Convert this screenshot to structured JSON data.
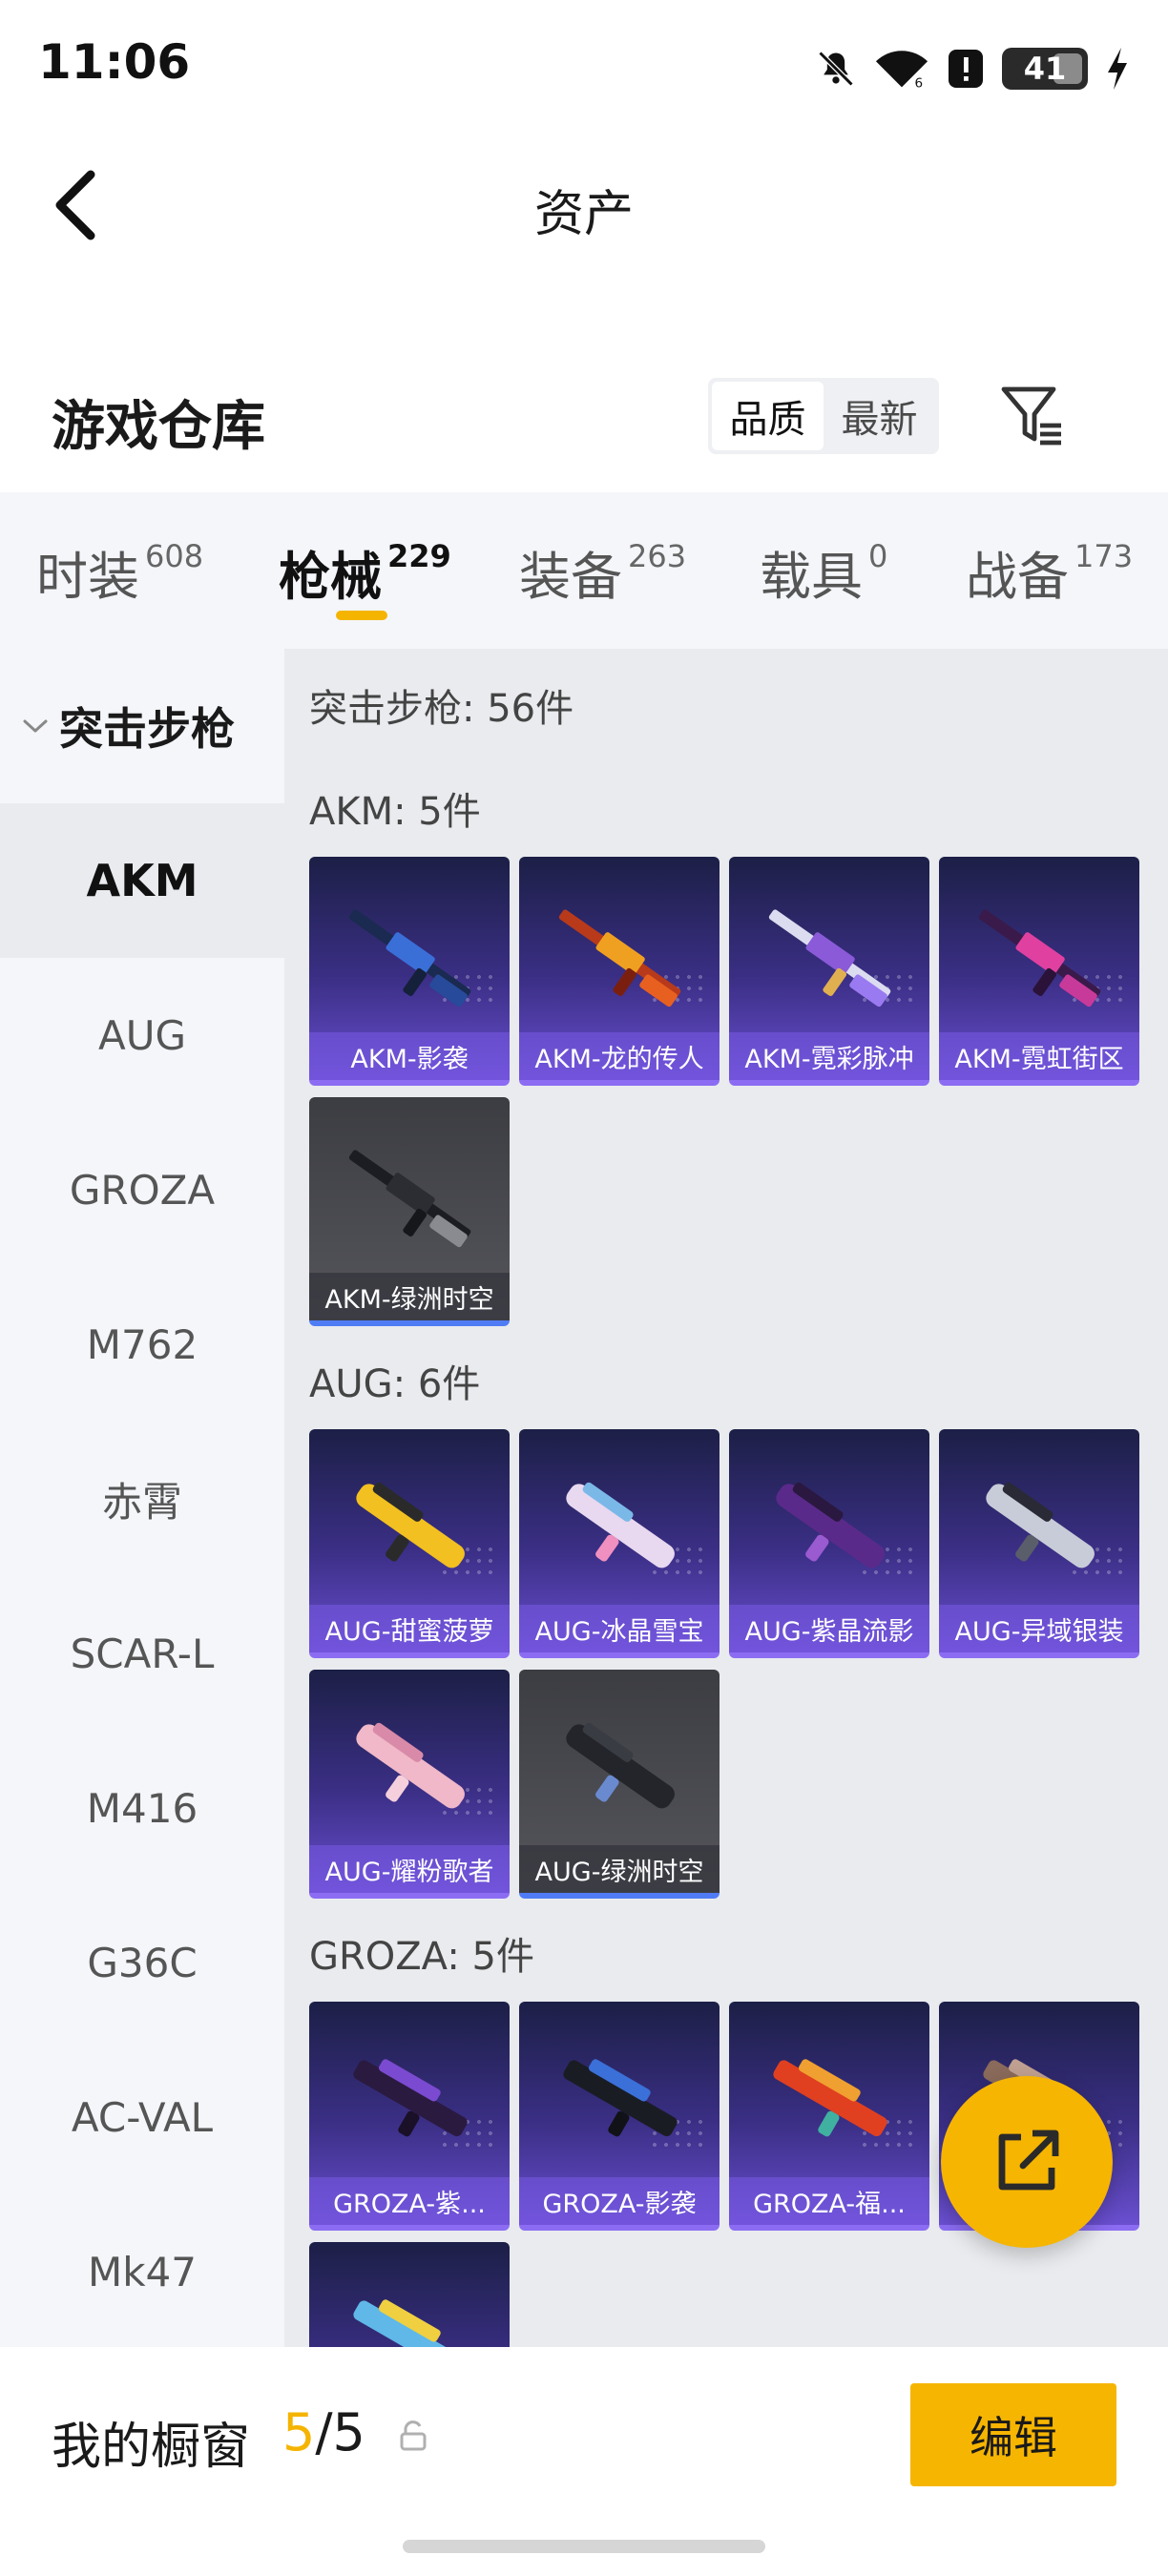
{
  "status_bar": {
    "time": "11:06",
    "battery": "41"
  },
  "header": {
    "title": "资产"
  },
  "warehouse": {
    "title": "游戏仓库",
    "sort_options": [
      "品质",
      "最新"
    ]
  },
  "tabs": [
    {
      "label": "时装",
      "count": "608"
    },
    {
      "label": "枪械",
      "count": "229"
    },
    {
      "label": "装备",
      "count": "263"
    },
    {
      "label": "载具",
      "count": "0"
    },
    {
      "label": "战备",
      "count": "173"
    }
  ],
  "sidebar": {
    "group": "突击步枪",
    "items": [
      "AKM",
      "AUG",
      "GROZA",
      "M762",
      "赤霄",
      "SCAR-L",
      "M416",
      "G36C",
      "AC-VAL",
      "Mk47"
    ]
  },
  "main": {
    "header": "突击步枪: 56件",
    "groups": [
      {
        "title": "AKM: 5件",
        "items": [
          "AKM-影袭",
          "AKM-龙的传人",
          "AKM-霓彩脉冲",
          "AKM-霓虹街区",
          "AKM-绿洲时空"
        ]
      },
      {
        "title": "AUG: 6件",
        "items": [
          "AUG-甜蜜菠萝",
          "AUG-冰晶雪宝",
          "AUG-紫晶流影",
          "AUG-异域银装",
          "AUG-耀粉歌者",
          "AUG-绿洲时空"
        ]
      },
      {
        "title": "GROZA: 5件",
        "items": [
          "GROZA-紫...",
          "GROZA-影袭",
          "GROZA-福..."
        ]
      }
    ]
  },
  "bottom": {
    "showcase_label": "我的橱窗",
    "showcase_current": "5",
    "showcase_total": "/5",
    "edit_label": "编辑"
  },
  "colors": {
    "accent": "#f6b500",
    "card_purple": "#6a4fd0",
    "card_grey": "#55565c"
  }
}
